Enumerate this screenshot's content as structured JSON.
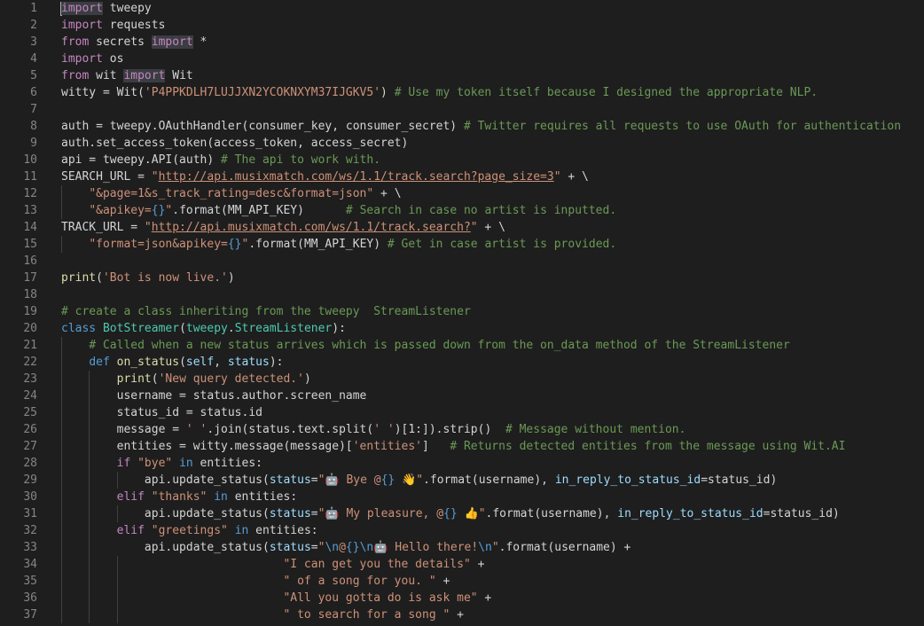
{
  "editor": {
    "lines": [
      [
        [
          "kw-hl",
          "import"
        ],
        [
          "var",
          " tweepy"
        ]
      ],
      [
        [
          "kw",
          "import"
        ],
        [
          "var",
          " requests"
        ]
      ],
      [
        [
          "kw",
          "from"
        ],
        [
          "var",
          " secrets "
        ],
        [
          "kw-hl",
          "import"
        ],
        [
          "var",
          " *"
        ]
      ],
      [
        [
          "kw",
          "import"
        ],
        [
          "var",
          " os"
        ]
      ],
      [
        [
          "kw",
          "from"
        ],
        [
          "var",
          " wit "
        ],
        [
          "kw-hl",
          "import"
        ],
        [
          "var",
          " Wit"
        ]
      ],
      [
        [
          "var",
          "witty = Wit("
        ],
        [
          "str",
          "'P4PPKDLH7LUJJXN2YCOKNXYM37IJGKV5'"
        ],
        [
          "var",
          ") "
        ],
        [
          "cm",
          "# Use my token itself because I designed the appropriate NLP."
        ]
      ],
      [],
      [
        [
          "var",
          "auth = tweepy.OAuthHandler(consumer_key, consumer_secret) "
        ],
        [
          "cm",
          "# Twitter requires all requests to use OAuth for authentication"
        ]
      ],
      [
        [
          "var",
          "auth.set_access_token(access_token, access_secret)"
        ]
      ],
      [
        [
          "var",
          "api = tweepy.API(auth) "
        ],
        [
          "cm",
          "# The api to work with."
        ]
      ],
      [
        [
          "var",
          "SEARCH_URL = "
        ],
        [
          "str",
          "\""
        ],
        [
          "url",
          "http://api.musixmatch.com/ws/1.1/track.search?page_size=3"
        ],
        [
          "str",
          "\""
        ],
        [
          "var",
          " + \\"
        ]
      ],
      [
        [
          "var",
          "    "
        ],
        [
          "str",
          "\"&page=1&s_track_rating=desc&format=json\""
        ],
        [
          "var",
          " + \\"
        ]
      ],
      [
        [
          "var",
          "    "
        ],
        [
          "str",
          "\"&apikey="
        ],
        [
          "kwb",
          "{}"
        ],
        [
          "str",
          "\""
        ],
        [
          "var",
          ".format(MM_API_KEY)      "
        ],
        [
          "cm",
          "# Search in case no artist is inputted."
        ]
      ],
      [
        [
          "var",
          "TRACK_URL = "
        ],
        [
          "str",
          "\""
        ],
        [
          "url",
          "http://api.musixmatch.com/ws/1.1/track.search?"
        ],
        [
          "str",
          "\""
        ],
        [
          "var",
          " + \\"
        ]
      ],
      [
        [
          "var",
          "    "
        ],
        [
          "str",
          "\"format=json&apikey="
        ],
        [
          "kwb",
          "{}"
        ],
        [
          "str",
          "\""
        ],
        [
          "var",
          ".format(MM_API_KEY) "
        ],
        [
          "cm",
          "# Get in case artist is provided."
        ]
      ],
      [],
      [
        [
          "fn",
          "print"
        ],
        [
          "var",
          "("
        ],
        [
          "str",
          "'Bot is now live.'"
        ],
        [
          "var",
          ")"
        ]
      ],
      [],
      [
        [
          "cm",
          "# create a class inheriting from the tweepy  StreamListener"
        ]
      ],
      [
        [
          "kwb",
          "class"
        ],
        [
          "var",
          " "
        ],
        [
          "cls",
          "BotStreamer"
        ],
        [
          "var",
          "("
        ],
        [
          "cls",
          "tweepy"
        ],
        [
          "var",
          "."
        ],
        [
          "cls",
          "StreamListener"
        ],
        [
          "var",
          "):"
        ]
      ],
      [
        [
          "var",
          "    "
        ],
        [
          "cm",
          "# Called when a new status arrives which is passed down from the on_data method of the StreamListener"
        ]
      ],
      [
        [
          "var",
          "    "
        ],
        [
          "kwb",
          "def"
        ],
        [
          "var",
          " "
        ],
        [
          "fn",
          "on_status"
        ],
        [
          "var",
          "("
        ],
        [
          "prm",
          "self"
        ],
        [
          "var",
          ", "
        ],
        [
          "prm",
          "status"
        ],
        [
          "var",
          "):"
        ]
      ],
      [
        [
          "var",
          "        "
        ],
        [
          "fn",
          "print"
        ],
        [
          "var",
          "("
        ],
        [
          "str",
          "'New query detected.'"
        ],
        [
          "var",
          ")"
        ]
      ],
      [
        [
          "var",
          "        username = status.author.screen_name"
        ]
      ],
      [
        [
          "var",
          "        status_id = status.id"
        ]
      ],
      [
        [
          "var",
          "        message = "
        ],
        [
          "str",
          "' '"
        ],
        [
          "var",
          ".join(status.text.split("
        ],
        [
          "str",
          "' '"
        ],
        [
          "var",
          ")[1:]).strip()  "
        ],
        [
          "cm",
          "# Message without mention."
        ]
      ],
      [
        [
          "var",
          "        entities = witty.message(message)["
        ],
        [
          "str",
          "'entities'"
        ],
        [
          "var",
          "]   "
        ],
        [
          "cm",
          "# Returns detected entities from the message using Wit.AI"
        ]
      ],
      [
        [
          "var",
          "        "
        ],
        [
          "kw",
          "if"
        ],
        [
          "var",
          " "
        ],
        [
          "str",
          "\"bye\""
        ],
        [
          "var",
          " "
        ],
        [
          "kwb",
          "in"
        ],
        [
          "var",
          " entities:"
        ]
      ],
      [
        [
          "var",
          "            api.update_status("
        ],
        [
          "prm",
          "status"
        ],
        [
          "var",
          "="
        ],
        [
          "str",
          "\"🤖 Bye @"
        ],
        [
          "kwb",
          "{}"
        ],
        [
          "str",
          " 👋\""
        ],
        [
          "var",
          ".format(username), "
        ],
        [
          "prm",
          "in_reply_to_status_id"
        ],
        [
          "var",
          "=status_id)"
        ]
      ],
      [
        [
          "var",
          "        "
        ],
        [
          "kw",
          "elif"
        ],
        [
          "var",
          " "
        ],
        [
          "str",
          "\"thanks\""
        ],
        [
          "var",
          " "
        ],
        [
          "kwb",
          "in"
        ],
        [
          "var",
          " entities:"
        ]
      ],
      [
        [
          "var",
          "            api.update_status("
        ],
        [
          "prm",
          "status"
        ],
        [
          "var",
          "="
        ],
        [
          "str",
          "\"🤖 My pleasure, @"
        ],
        [
          "kwb",
          "{}"
        ],
        [
          "str",
          " 👍\""
        ],
        [
          "var",
          ".format(username), "
        ],
        [
          "prm",
          "in_reply_to_status_id"
        ],
        [
          "var",
          "=status_id)"
        ]
      ],
      [
        [
          "var",
          "        "
        ],
        [
          "kw",
          "elif"
        ],
        [
          "var",
          " "
        ],
        [
          "str",
          "\"greetings\""
        ],
        [
          "var",
          " "
        ],
        [
          "kwb",
          "in"
        ],
        [
          "var",
          " entities:"
        ]
      ],
      [
        [
          "var",
          "            api.update_status("
        ],
        [
          "prm",
          "status"
        ],
        [
          "var",
          "="
        ],
        [
          "str",
          "\""
        ],
        [
          "kwb",
          "\\n"
        ],
        [
          "str",
          "@"
        ],
        [
          "kwb",
          "{}"
        ],
        [
          "kwb",
          "\\n"
        ],
        [
          "str",
          "🤖 Hello there!"
        ],
        [
          "kwb",
          "\\n"
        ],
        [
          "str",
          "\""
        ],
        [
          "var",
          ".format(username) +"
        ]
      ],
      [
        [
          "var",
          "                                "
        ],
        [
          "str",
          "\"I can get you the details\""
        ],
        [
          "var",
          " +"
        ]
      ],
      [
        [
          "var",
          "                                "
        ],
        [
          "str",
          "\" of a song for you. \""
        ],
        [
          "var",
          " +"
        ]
      ],
      [
        [
          "var",
          "                                "
        ],
        [
          "str",
          "\"All you gotta do is ask me\""
        ],
        [
          "var",
          " +"
        ]
      ],
      [
        [
          "var",
          "                                "
        ],
        [
          "str",
          "\" to search for a song \""
        ],
        [
          "var",
          " +"
        ]
      ]
    ]
  },
  "colors": {
    "background": "#1e1e1e",
    "line_number": "#858585",
    "keyword": "#c586c0",
    "string": "#ce9178",
    "comment": "#6a9955",
    "function": "#dcdcaa",
    "class": "#4ec9b0"
  }
}
